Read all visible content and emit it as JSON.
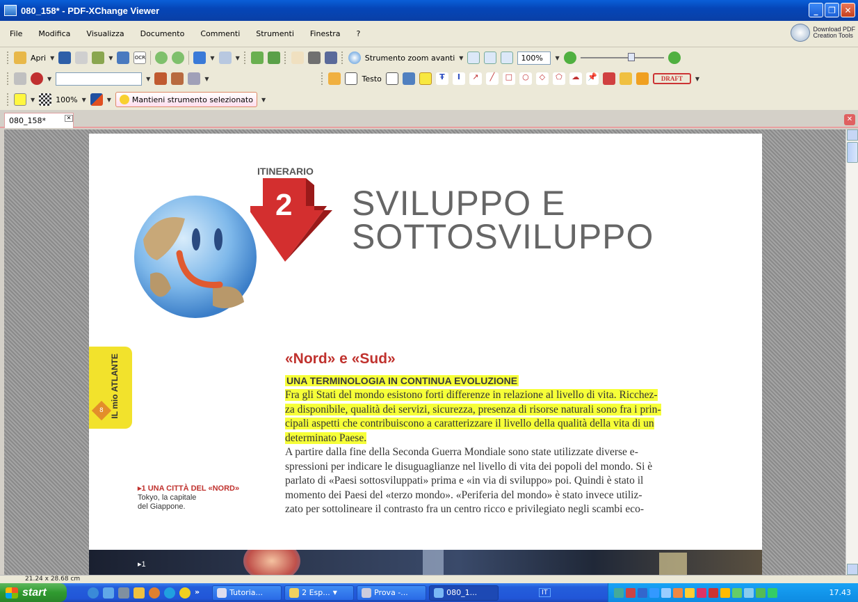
{
  "window": {
    "title": "080_158* - PDF-XChange Viewer",
    "minimize": "_",
    "maximize": "❐",
    "close": "✕"
  },
  "menu": [
    "File",
    "Modifica",
    "Visualizza",
    "Documento",
    "Commenti",
    "Strumenti",
    "Finestra",
    "?"
  ],
  "download_tools": {
    "line1": "Download PDF",
    "line2": "Creation Tools"
  },
  "toolbar1": {
    "open_label": "Apri",
    "ocr_label": "OCR",
    "zoom_tool_label": "Strumento zoom avanti",
    "zoom_level": "100%"
  },
  "toolbar2": {
    "text_label": "Testo",
    "stamp_label": "DRAFT"
  },
  "toolbar3": {
    "opacity": "100%",
    "keep_tool_label": "Mantieni strumento selezionato"
  },
  "tab": {
    "label": "080_158*",
    "close": "✕"
  },
  "document": {
    "itinerario": "ITINERARIO",
    "number": "2",
    "title_line1": "SVILUPPO E",
    "title_line2": "SOTTOSVILUPPO",
    "side_tab_line1": "IL mio",
    "side_tab_line2": "ATLANTE",
    "side_tab_number": "8",
    "heading": "«Nord» e «Sud»",
    "subheading": "UNA TERMINOLOGIA IN CONTINUA EVOLUZIONE",
    "highlighted_lines": [
      "Fra gli Stati del mondo esistono forti differenze in relazione al livello di vita. Ricchez-",
      "za disponibile, qualità dei servizi, sicurezza, presenza di risorse naturali sono fra i prin-",
      "cipali aspetti che contribuiscono a caratterizzare il livello della qualità della vita di un",
      "determinato Paese."
    ],
    "paragraph_lines": [
      "A partire dalla fine della Seconda Guerra Mondiale sono state utilizzate diverse e-",
      "spressioni per indicare le disuguaglianze nel livello di vita dei popoli del mondo. Si è",
      "parlato di «Paesi sottosviluppati» prima e «in via di sviluppo» poi. Quindi è stato il",
      "momento dei Paesi del «terzo mondo». «Periferia del mondo» è stato invece utiliz-",
      "zato per sottolineare il contrasto fra un centro ricco e privilegiato negli scambi eco-"
    ],
    "caption_title": "▸1 UNA CITTÀ DEL «NORD»",
    "caption_line1": "Tokyo, la capitale",
    "caption_line2": "del Giappone.",
    "photo_label": "▸1"
  },
  "statusbar": {
    "size": "21.24 x 28.68 cm"
  },
  "taskbar": {
    "start": "start",
    "chevron": "»",
    "buttons": [
      "Tutoria...",
      "2 Esp...",
      "Prova -...",
      "080_1..."
    ],
    "language": "IT",
    "clock": "17.43"
  }
}
